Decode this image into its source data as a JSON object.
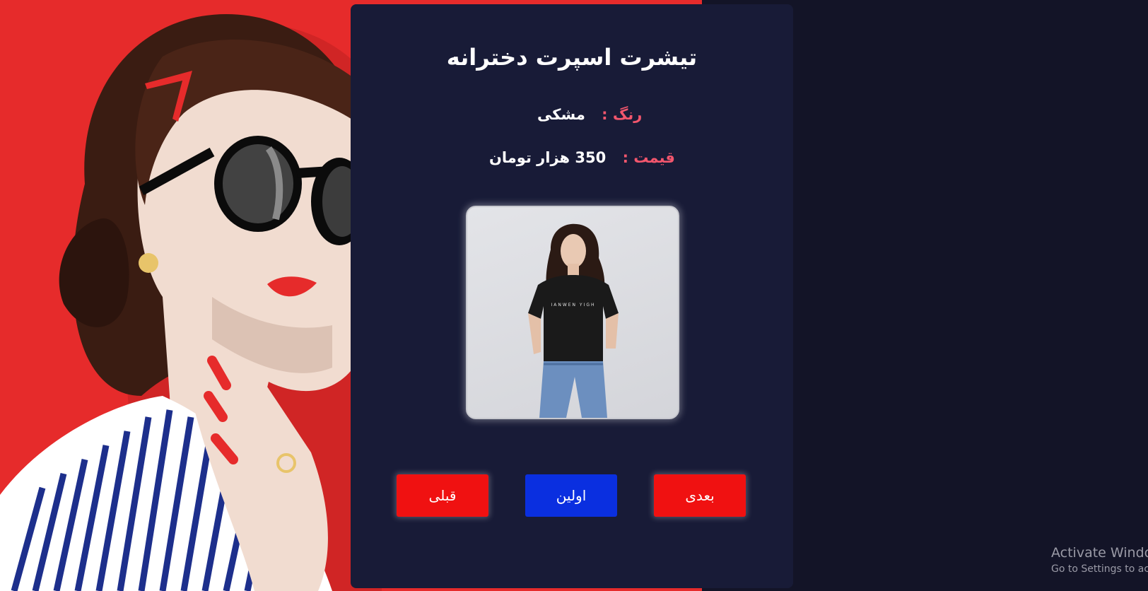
{
  "product": {
    "title": "تیشرت اسپرت دخترانه",
    "color_label": "رنگ :",
    "color_value": "مشکی",
    "price_label": "قیمت :",
    "price_value": "350 هزار تومان",
    "image": "woman-black-tshirt-photo"
  },
  "hero": {
    "image": "woman-sunglasses-illustration"
  },
  "buttons": {
    "next": "بعدی",
    "first": "اولین",
    "prev": "قبلی"
  },
  "watermark": {
    "line1": "Activate Windo",
    "line2": "Go to Settings to act"
  },
  "colors": {
    "hero_bg": "#e62b2b",
    "card_bg": "#181b37",
    "page_bg": "#131427",
    "label": "#f2566d",
    "button_red": "#f01111",
    "button_blue": "#0a2fe0"
  }
}
